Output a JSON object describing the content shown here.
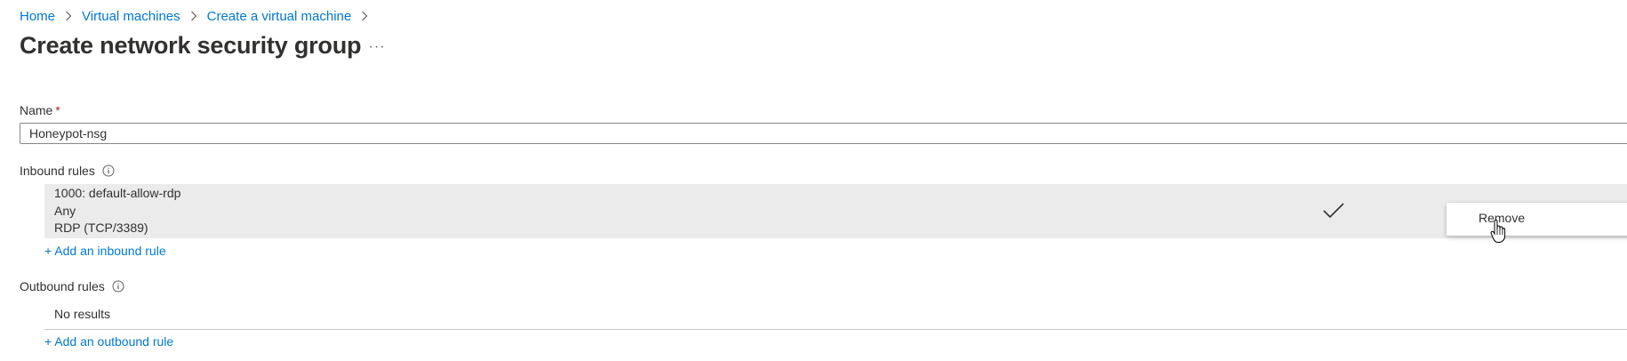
{
  "breadcrumb": {
    "items": [
      "Home",
      "Virtual machines",
      "Create a virtual machine"
    ]
  },
  "page": {
    "title": "Create network security group",
    "more_label": "···"
  },
  "name_field": {
    "label": "Name",
    "required_mark": "*",
    "value": "Honeypot-nsg"
  },
  "inbound": {
    "label": "Inbound rules",
    "rules": [
      {
        "name": "1000: default-allow-rdp",
        "source": "Any",
        "service": "RDP (TCP/3389)"
      }
    ],
    "context_menu": {
      "remove_label": "Remove"
    },
    "add_label": "+ Add an inbound rule"
  },
  "outbound": {
    "label": "Outbound rules",
    "empty_text": "No results",
    "add_label": "+ Add an outbound rule"
  },
  "colors": {
    "link": "#0078d4",
    "text": "#323130",
    "required": "#a4262c",
    "row_selected": "#ebebeb"
  },
  "icons": [
    "chevron-right-icon",
    "info-icon",
    "checkmark-icon",
    "hand-cursor-icon"
  ]
}
